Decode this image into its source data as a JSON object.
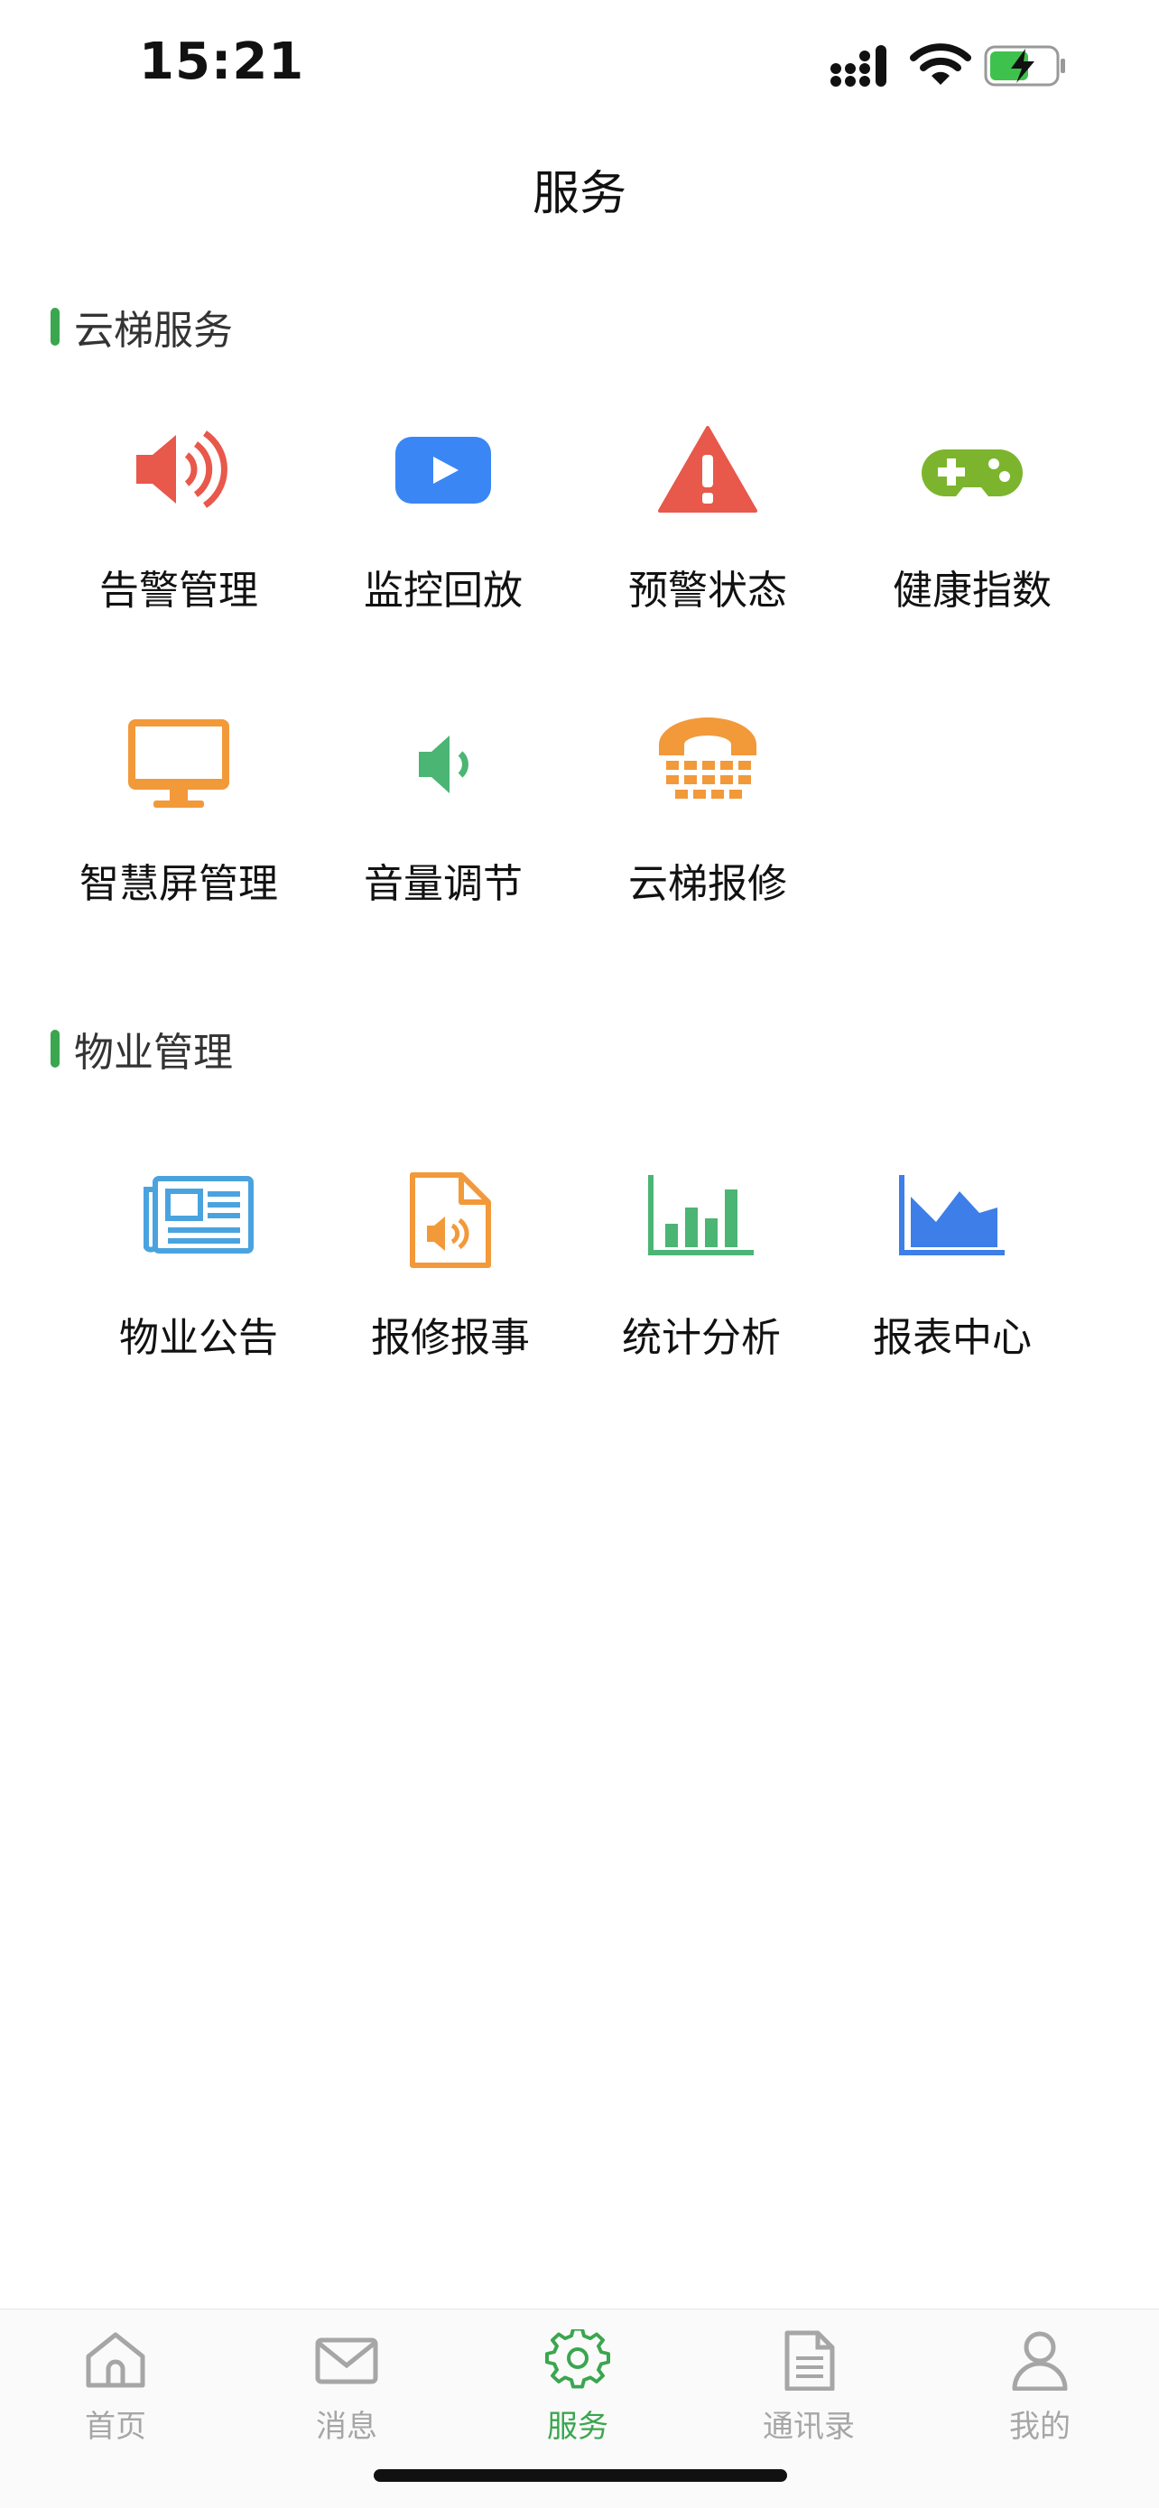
{
  "status_bar": {
    "time": "15:21"
  },
  "header": {
    "title": "服务"
  },
  "colors": {
    "accent": "#3aa64f",
    "red": "#e8584b",
    "blue": "#3b86f5",
    "green_game": "#7cb52d",
    "orange": "#f2993a",
    "green": "#4bb574",
    "light_blue": "#4aa3df",
    "chart_blue": "#3d7ee8",
    "tab_inactive": "#a6a6a6"
  },
  "sections": [
    {
      "title": "云梯服务",
      "items": [
        {
          "label": "告警管理",
          "icon": "alarm-speaker-icon"
        },
        {
          "label": "监控回放",
          "icon": "video-play-icon"
        },
        {
          "label": "预警状态",
          "icon": "warning-triangle-icon"
        },
        {
          "label": "健康指数",
          "icon": "gamepad-icon"
        },
        {
          "label": "智慧屏管理",
          "icon": "monitor-icon"
        },
        {
          "label": "音量调节",
          "icon": "volume-icon"
        },
        {
          "label": "云梯报修",
          "icon": "telephone-icon"
        }
      ]
    },
    {
      "title": "物业管理",
      "items": [
        {
          "label": "物业公告",
          "icon": "newspaper-icon"
        },
        {
          "label": "报修报事",
          "icon": "audio-file-icon"
        },
        {
          "label": "统计分析",
          "icon": "bar-chart-icon"
        },
        {
          "label": "报表中心",
          "icon": "area-chart-icon"
        }
      ]
    }
  ],
  "tab_bar": {
    "tabs": [
      {
        "label": "首页",
        "icon": "home-icon"
      },
      {
        "label": "消息",
        "icon": "mail-icon"
      },
      {
        "label": "服务",
        "icon": "gear-icon",
        "active": true
      },
      {
        "label": "通讯录",
        "icon": "document-icon"
      },
      {
        "label": "我的",
        "icon": "user-icon"
      }
    ]
  }
}
